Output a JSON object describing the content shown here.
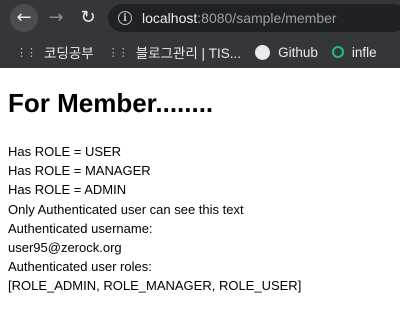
{
  "browser": {
    "url_host": "localhost",
    "url_rest": ":8080/sample/member",
    "bookmarks": [
      {
        "label": "코딩공부",
        "icon": "dots-icon"
      },
      {
        "label": "블로그관리 | TIS...",
        "icon": "dots-icon"
      },
      {
        "label": "Github",
        "icon": "github-icon"
      },
      {
        "label": "infle",
        "icon": "inflearn-icon"
      }
    ]
  },
  "page": {
    "title": "For Member........",
    "lines": [
      "Has ROLE = USER",
      "Has ROLE = MANAGER",
      "Has ROLE = ADMIN",
      "Only Authenticated user can see this text",
      "Authenticated username:",
      "user95@zerock.org",
      "Authenticated user roles:",
      "[ROLE_ADMIN, ROLE_MANAGER, ROLE_USER]"
    ]
  }
}
